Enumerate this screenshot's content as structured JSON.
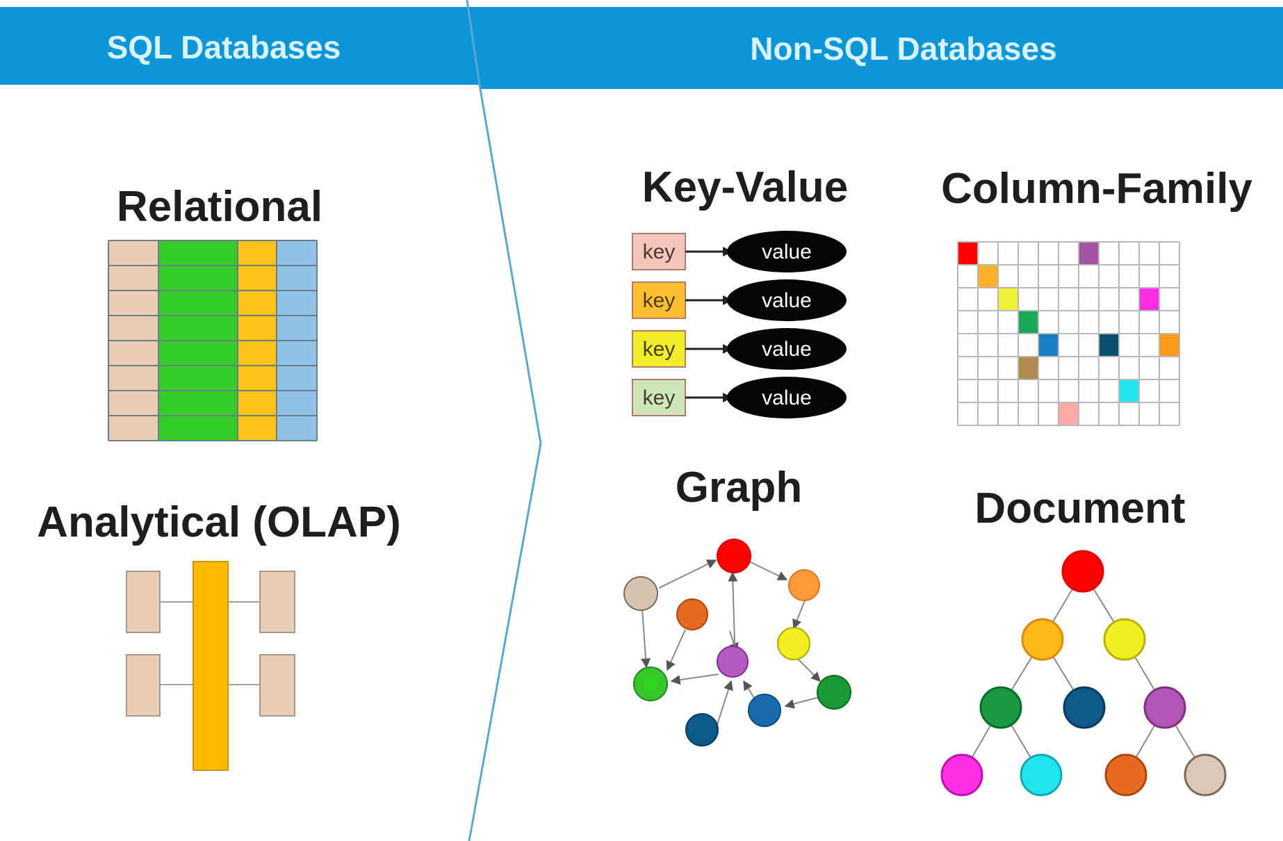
{
  "header": {
    "sql_label": "SQL Databases",
    "nosql_label": "Non-SQL Databases",
    "color": "#0c96d8"
  },
  "sections": {
    "relational": "Relational",
    "analytical": "Analytical (OLAP)",
    "key_value": "Key-Value",
    "column_family": "Column-Family",
    "graph": "Graph",
    "document": "Document"
  },
  "key_value": {
    "rows": [
      {
        "key": "key",
        "value": "value",
        "key_color": "#f6c6bd"
      },
      {
        "key": "key",
        "value": "value",
        "key_color": "#ffbf2e"
      },
      {
        "key": "key",
        "value": "value",
        "key_color": "#f0ee2a"
      },
      {
        "key": "key",
        "value": "value",
        "key_color": "#cde7b8"
      }
    ]
  },
  "relational_columns": [
    "#e8cdb8",
    "#35cc2a",
    "#ffc21a",
    "#8fc3ea"
  ],
  "column_family_cells": [
    {
      "row": 0,
      "col": 0,
      "color": "#ff0000"
    },
    {
      "row": 0,
      "col": 6,
      "color": "#a452a6"
    },
    {
      "row": 1,
      "col": 1,
      "color": "#ffb32a"
    },
    {
      "row": 2,
      "col": 2,
      "color": "#eef03a"
    },
    {
      "row": 2,
      "col": 9,
      "color": "#ff2fe6"
    },
    {
      "row": 3,
      "col": 3,
      "color": "#18a85a"
    },
    {
      "row": 4,
      "col": 4,
      "color": "#1a7ec2"
    },
    {
      "row": 4,
      "col": 7,
      "color": "#0d4f70"
    },
    {
      "row": 4,
      "col": 10,
      "color": "#ff9a1a"
    },
    {
      "row": 5,
      "col": 3,
      "color": "#b08a50"
    },
    {
      "row": 6,
      "col": 8,
      "color": "#22e4f0"
    },
    {
      "row": 7,
      "col": 5,
      "color": "#ffaaa8"
    }
  ]
}
